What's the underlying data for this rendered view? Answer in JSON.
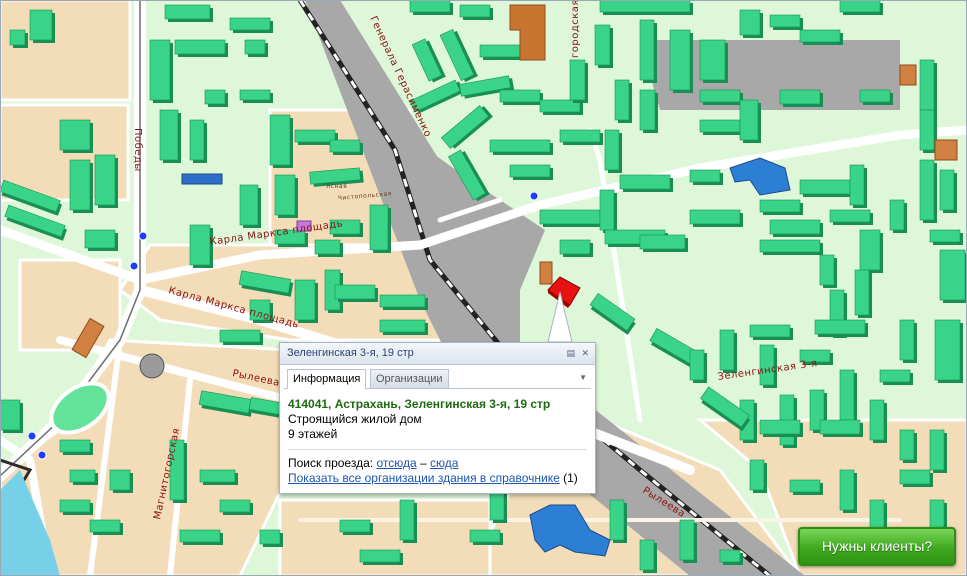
{
  "streets": {
    "pobedy": "Победы",
    "generala_gerasimenko": "Генерала Герасименко",
    "karla_marksa_1": "Карла Маркса площадь",
    "karla_marksa_2": "Карла Маркса площадь",
    "ryleeva_left": "Рылеева",
    "ryleeva_right": "Рылеева",
    "zelenginskaya": "Зеленгинская 3-я",
    "magnitogorskaya": "Магнитогорская",
    "gorodskaya": "городская",
    "chistopolskaya": "Чистопольская",
    "yasnaya": "Ясная"
  },
  "popup": {
    "title": "Зеленгинская 3-я, 19 стр",
    "tabs": [
      "Информация",
      "Организации"
    ],
    "address": "414041, Астрахань, Зеленгинская 3-я, 19 стр",
    "type": "Строящийся жилой дом",
    "floors": "9 этажей",
    "route_label": "Поиск проезда:",
    "route_from": "отсюда",
    "route_dash": "–",
    "route_to": "сюда",
    "show_orgs": "Показать все организации здания в справочнике",
    "org_count": "(1)"
  },
  "cta": {
    "label": "Нужны клиенты?"
  },
  "colors": {
    "background": "#ddf7d8",
    "block": "#f3dcb8",
    "building": "#39d487",
    "building_dark": "#1a8f55",
    "building_blue": "#2e7fd8",
    "building_orange": "#d17e3a",
    "selected": "#e81212",
    "rail": "#2b2b2b",
    "road": "#ffffff",
    "highway": "#a9a9a9"
  }
}
